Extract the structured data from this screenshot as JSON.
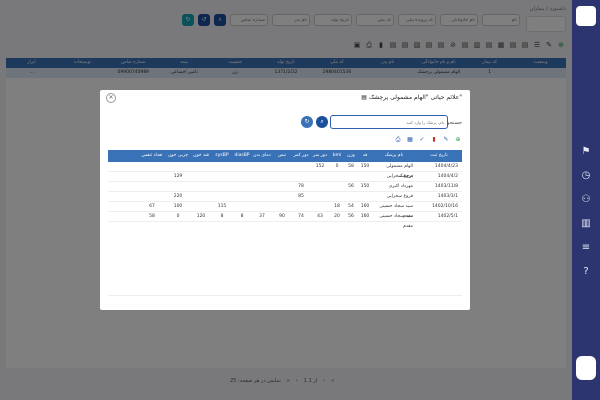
{
  "breadcrumb": {
    "home": "داشبورد",
    "current": "بیماران"
  },
  "filters": [
    {
      "name": "name-filter",
      "placeholder": "نام"
    },
    {
      "name": "family-filter",
      "placeholder": "نام خانوادگی"
    },
    {
      "name": "patient-code-filter",
      "placeholder": "کد پرونده ملی"
    },
    {
      "name": "national-code-filter",
      "placeholder": "کد ملی"
    },
    {
      "name": "birth-date-filter",
      "placeholder": "تاریخ تولد"
    },
    {
      "name": "father-filter",
      "placeholder": "نام پدر"
    },
    {
      "name": "phone-filter",
      "placeholder": "شماره تماس"
    }
  ],
  "toolbar_icons": [
    "plus-icon",
    "edit-icon",
    "list-icon",
    "file-icon",
    "file-icon",
    "calendar-icon",
    "file-icon",
    "report-icon",
    "file-icon",
    "block-icon",
    "file-icon",
    "file-icon",
    "book-icon",
    "file-icon",
    "file-icon",
    "trash-icon",
    "print-icon",
    "image-icon"
  ],
  "back_table": {
    "headers": [
      "وضعیت",
      "کد بیمار",
      "نام و نام خانوادگی",
      "نام پدر",
      "کد ملی",
      "تاریخ تولد",
      "جنسیت",
      "بیمه",
      "شماره تماس",
      "توضیحات",
      "ابزار"
    ],
    "row": [
      "",
      "1",
      "الهام مشمولی پرچشک",
      "",
      "2980401536",
      "1371/2/22",
      "زن",
      "تامین اجتماعی",
      "09900740989",
      "",
      "..."
    ]
  },
  "pager": {
    "page_size_label": "نمایش در هر صفحه: 25",
    "page_info": "1 از 1",
    "first": "«",
    "prev": "‹",
    "next": "›",
    "last": "»"
  },
  "modal": {
    "title": "علائم حیاتی \"الهام مشمولی پرچشک\"",
    "search_label": "جستجو",
    "search_placeholder": "نام، پزشک را وارد کنید",
    "headers": [
      "تاریخ ثبت",
      "نام پزشک",
      "قد",
      "وزن",
      "bmi",
      "دور سر",
      "دور کمر",
      "نبض",
      "دمای بدن",
      "diasBP",
      "sysBP",
      "قند خون",
      "چربی خون",
      "تعداد تنفس"
    ],
    "rows": [
      [
        "1404/4/23",
        "الهام مشمولی پرچشک",
        "150",
        "58",
        "0",
        "152",
        "",
        "",
        "",
        "",
        "",
        "",
        "",
        ""
      ],
      [
        "1404/4/2",
        "فروغ سخرایی",
        "",
        "",
        "",
        "",
        "",
        "",
        "",
        "",
        "",
        "",
        "129",
        ""
      ],
      [
        "1403/11/8",
        "مهرداد اکبری",
        "150",
        "56",
        "",
        "",
        "78",
        "",
        "",
        "",
        "",
        "",
        "",
        ""
      ],
      [
        "1403/3/1",
        "فروغ سخرایی",
        "",
        "",
        "",
        "",
        "85",
        "",
        "",
        "",
        "",
        "",
        "220",
        ""
      ],
      [
        "1402/10/16",
        "سید سجاد حسینی مقدم",
        "160",
        "54",
        "18",
        "",
        "",
        "",
        "",
        "",
        "115",
        "",
        "100",
        "67"
      ],
      [
        "1402/5/1",
        "سید سجاد حسینی مقدم",
        "160",
        "56",
        "20",
        "43",
        "74",
        "90",
        "37",
        "8",
        "8",
        "120",
        "0",
        "58"
      ]
    ]
  }
}
